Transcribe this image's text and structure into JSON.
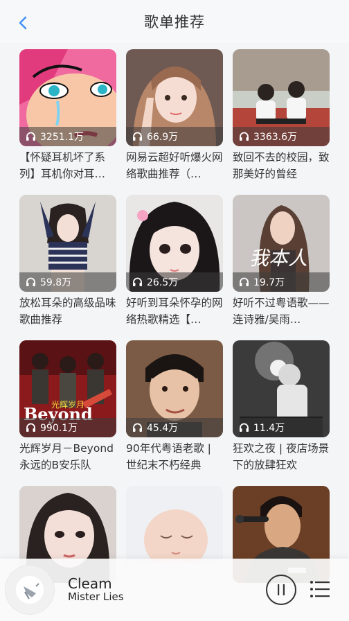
{
  "header": {
    "title": "歌单推荐",
    "back_icon": "chevron-left-icon",
    "accent": "#3d8ff5"
  },
  "playlists": [
    {
      "title": "【怀疑耳机坏了系列】耳机你对耳…",
      "plays": "3251.1万"
    },
    {
      "title": "网易云超好听爆火网络歌曲推荐（…",
      "plays": "66.9万"
    },
    {
      "title": "致回不去的校园，致那美好的曾经",
      "plays": "3363.6万"
    },
    {
      "title": "放松耳朵的高级品味歌曲推荐",
      "plays": "59.8万"
    },
    {
      "title": "好听到耳朵怀孕的网络热歌精选【…",
      "plays": "26.5万"
    },
    {
      "title": "好听不过粤语歌——连诗雅/吴雨…",
      "plays": "19.7万",
      "cover_text": "我本人"
    },
    {
      "title": "光辉岁月－Beyond永远的B安乐队",
      "plays": "990.1万",
      "cover_text": "Beyond",
      "cover_subtext": "光辉岁月"
    },
    {
      "title": "90年代粤语老歌 | 世纪末不朽经典",
      "plays": "45.4万"
    },
    {
      "title": "狂欢之夜 | 夜店场景下的放肆狂欢",
      "plays": "11.4万"
    },
    {
      "title": "",
      "plays": ""
    },
    {
      "title": "",
      "plays": ""
    },
    {
      "title": "",
      "plays": ""
    }
  ],
  "player": {
    "song": "Cleam",
    "artist": "Mister Lies",
    "pause_icon": "pause-icon",
    "playlist_icon": "playlist-icon"
  }
}
